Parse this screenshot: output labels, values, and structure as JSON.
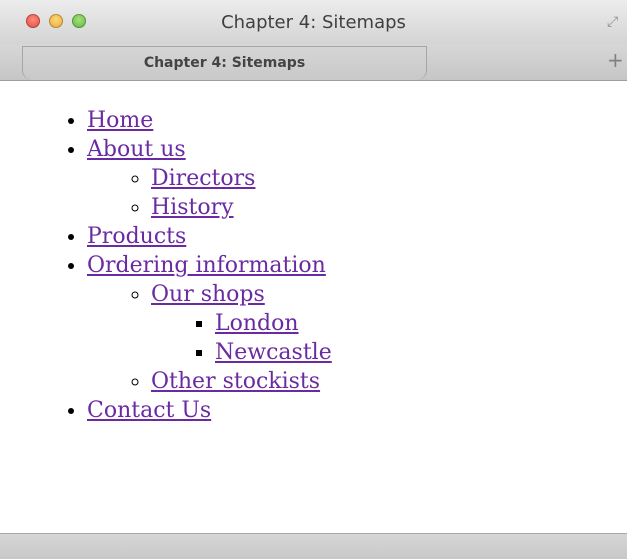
{
  "window": {
    "title": "Chapter 4: Sitemaps",
    "fullscreen_icon": "fullscreen-icon"
  },
  "tabs": [
    {
      "label": "Chapter 4: Sitemaps"
    }
  ],
  "new_tab_label": "+",
  "colors": {
    "link_visited": "#6a2aa1"
  },
  "sitemap": {
    "home": "Home",
    "about": "About us",
    "about_children": {
      "directors": "Directors",
      "history": "History"
    },
    "products": "Products",
    "ordering": "Ordering information",
    "ordering_children": {
      "shops": "Our shops",
      "shops_children": {
        "london": "London",
        "newcastle": "Newcastle"
      },
      "stockists": "Other stockists"
    },
    "contact": "Contact Us"
  }
}
